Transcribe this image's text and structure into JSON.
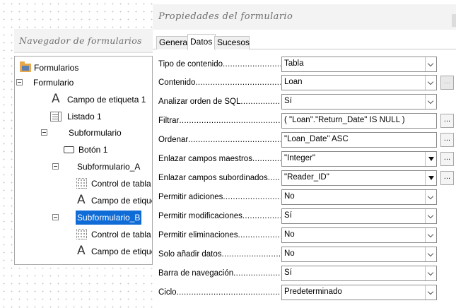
{
  "navigator": {
    "title": "Navegador de formularios",
    "tree": {
      "root": "Formularios",
      "formulario": "Formulario",
      "campo_etiqueta_1": "Campo de etiqueta 1",
      "listado_1": "Listado 1",
      "subformulario": "Subformulario",
      "boton_1": "Botón 1",
      "subformulario_a": "Subformulario_A",
      "control_tabla_a": "Control de tabla",
      "campo_etiqueta_a": "Campo de etique",
      "subformulario_b": "Subformulario_B",
      "control_tabla_b": "Control de tabla",
      "campo_etiqueta_b": "Campo de etique"
    },
    "selected": "Subformulario_B"
  },
  "properties": {
    "title": "Propiedades del formulario",
    "tabs": [
      "General",
      "Datos",
      "Sucesos"
    ],
    "active_tab": "Datos",
    "rows": [
      {
        "label": "Tipo de contenido",
        "value": "Tabla",
        "control": "dropdown"
      },
      {
        "label": "Contenido",
        "value": "Loan",
        "control": "dropdown"
      },
      {
        "label": "Analizar orden de SQL",
        "value": "Sí",
        "control": "dropdown"
      },
      {
        "label": "Filtrar",
        "value": " ( \"Loan\".\"Return_Date\" IS NULL )",
        "control": "text"
      },
      {
        "label": "Ordenar",
        "value": "\"Loan_Date\" ASC",
        "control": "text"
      },
      {
        "label": "Enlazar campos maestros",
        "value": "\"Integer\"",
        "control": "dropdown"
      },
      {
        "label": "Enlazar campos subordinados",
        "value": "\"Reader_ID\"",
        "control": "dropdown"
      },
      {
        "label": "Permitir adiciones",
        "value": "No",
        "control": "dropdown"
      },
      {
        "label": "Permitir modificaciones",
        "value": "Sí",
        "control": "dropdown"
      },
      {
        "label": "Permitir eliminaciones",
        "value": "No",
        "control": "dropdown"
      },
      {
        "label": "Solo añadir datos",
        "value": "No",
        "control": "dropdown"
      },
      {
        "label": "Barra de navegación",
        "value": "Sí",
        "control": "dropdown"
      },
      {
        "label": "Ciclo",
        "value": "Predeterminado",
        "control": "dropdown"
      }
    ],
    "ellipsis_label": "..."
  },
  "colors": {
    "selection": "#0f6bd6",
    "title_text": "#6f6f6f",
    "folder": "#e7a74a"
  },
  "icons": [
    "folder-icon",
    "expander-icon",
    "label-field-icon",
    "listbox-icon",
    "push-button-icon",
    "table-control-icon",
    "dropdown-arrow-icon",
    "ellipsis-button"
  ]
}
